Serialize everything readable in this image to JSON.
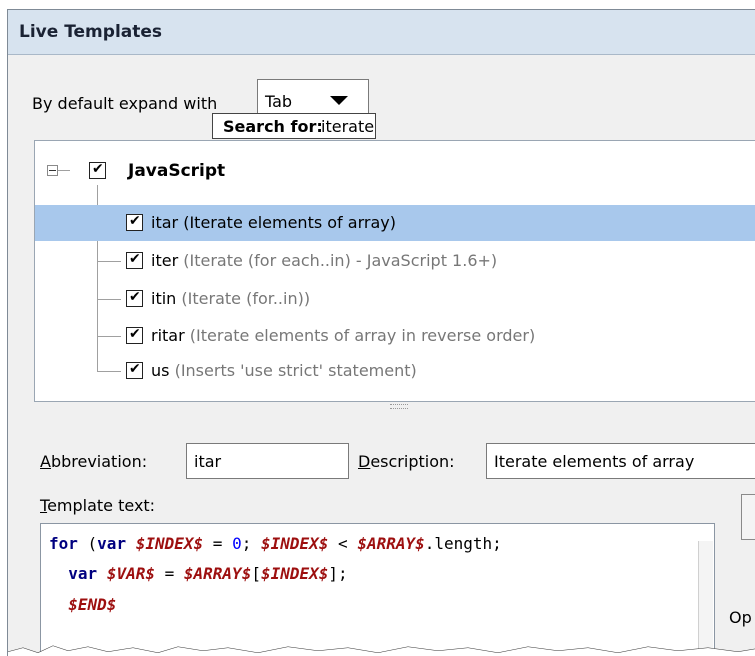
{
  "panel": {
    "title": "Live Templates"
  },
  "expand": {
    "label": "By default expand with",
    "value": "Tab"
  },
  "search": {
    "label": "Search for:",
    "value": "iterate"
  },
  "tree": {
    "group": {
      "label": "JavaScript",
      "checked": true
    },
    "items": [
      {
        "abbr": "itar",
        "desc": "(Iterate elements of array)",
        "checked": true,
        "selected": true
      },
      {
        "abbr": "iter",
        "desc": "(Iterate (for each..in) - JavaScript 1.6+)",
        "checked": true,
        "selected": false
      },
      {
        "abbr": "itin",
        "desc": "(Iterate (for..in))",
        "checked": true,
        "selected": false
      },
      {
        "abbr": "ritar",
        "desc": "(Iterate elements of array in reverse order)",
        "checked": true,
        "selected": false
      },
      {
        "abbr": "us",
        "desc": "(Inserts 'use strict' statement)",
        "checked": true,
        "selected": false
      }
    ]
  },
  "fields": {
    "abbreviation_label_u": "A",
    "abbreviation_label_rest": "bbreviation:",
    "abbreviation_value": "itar",
    "description_label_u": "D",
    "description_label_rest": "escription:",
    "description_value": "Iterate elements of array"
  },
  "template_text": {
    "label_u": "T",
    "label_rest": "emplate text:",
    "lines": [
      [
        {
          "t": "for",
          "c": "kw"
        },
        {
          "t": " (",
          "c": "pl"
        },
        {
          "t": "var",
          "c": "kw"
        },
        {
          "t": " ",
          "c": "pl"
        },
        {
          "t": "$INDEX$",
          "c": "vr"
        },
        {
          "t": " = ",
          "c": "pl"
        },
        {
          "t": "0",
          "c": "nm"
        },
        {
          "t": "; ",
          "c": "pl"
        },
        {
          "t": "$INDEX$",
          "c": "vr"
        },
        {
          "t": " < ",
          "c": "pl"
        },
        {
          "t": "$ARRAY$",
          "c": "vr"
        },
        {
          "t": ".length;",
          "c": "pl"
        }
      ],
      [
        {
          "t": "  ",
          "c": "pl"
        },
        {
          "t": "var",
          "c": "kw"
        },
        {
          "t": " ",
          "c": "pl"
        },
        {
          "t": "$VAR$",
          "c": "vr"
        },
        {
          "t": " = ",
          "c": "pl"
        },
        {
          "t": "$ARRAY$",
          "c": "vr"
        },
        {
          "t": "[",
          "c": "pl"
        },
        {
          "t": "$INDEX$",
          "c": "vr"
        },
        {
          "t": "];",
          "c": "pl"
        }
      ],
      [
        {
          "t": "  ",
          "c": "pl"
        },
        {
          "t": "$END$",
          "c": "vr"
        }
      ]
    ]
  },
  "side": {
    "options_label": "Op"
  },
  "colors": {
    "selection": "#a8c8ec",
    "keyword": "#000080",
    "variable": "#9d0f0f",
    "number": "#0000ff",
    "description_gray": "#777777"
  }
}
